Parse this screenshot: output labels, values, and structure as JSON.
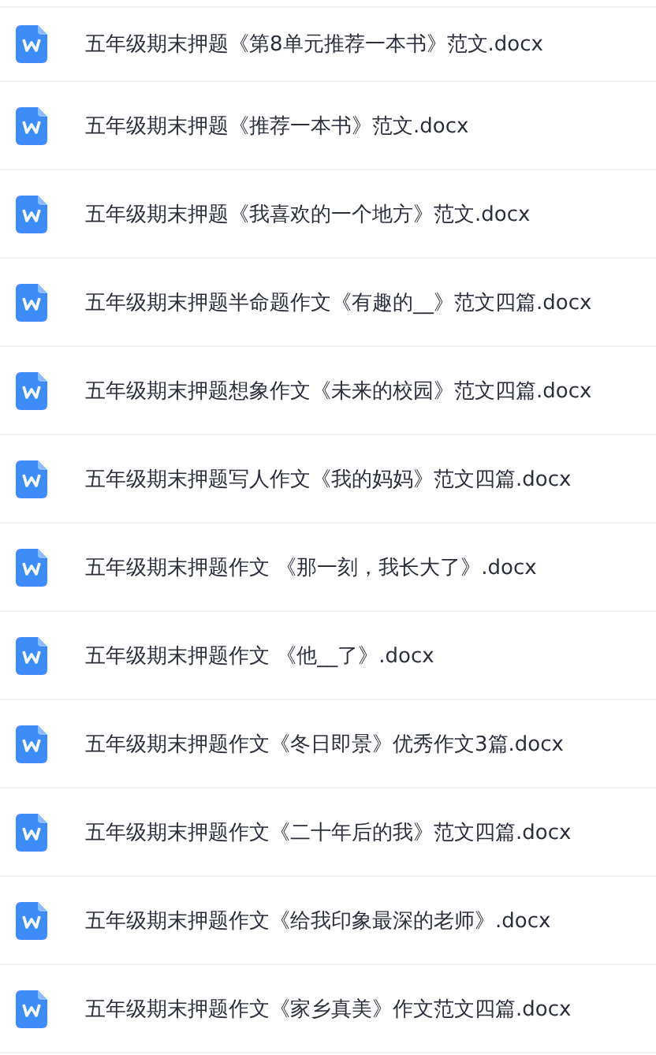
{
  "files": [
    {
      "name": "五年级期末押题《第8单元推荐一本书》范文.docx"
    },
    {
      "name": "五年级期末押题《推荐一本书》范文.docx"
    },
    {
      "name": "五年级期末押题《我喜欢的一个地方》范文.docx"
    },
    {
      "name": "五年级期末押题半命题作文《有趣的__》范文四篇.docx"
    },
    {
      "name": "五年级期末押题想象作文《未来的校园》范文四篇.docx"
    },
    {
      "name": "五年级期末押题写人作文《我的妈妈》范文四篇.docx"
    },
    {
      "name": "五年级期末押题作文 《那一刻，我长大了》.docx"
    },
    {
      "name": "五年级期末押题作文 《他__了》.docx"
    },
    {
      "name": "五年级期末押题作文《冬日即景》优秀作文3篇.docx"
    },
    {
      "name": "五年级期末押题作文《二十年后的我》范文四篇.docx"
    },
    {
      "name": "五年级期末押题作文《给我印象最深的老师》.docx"
    },
    {
      "name": "五年级期末押题作文《家乡真美》作文范文四篇.docx"
    }
  ]
}
